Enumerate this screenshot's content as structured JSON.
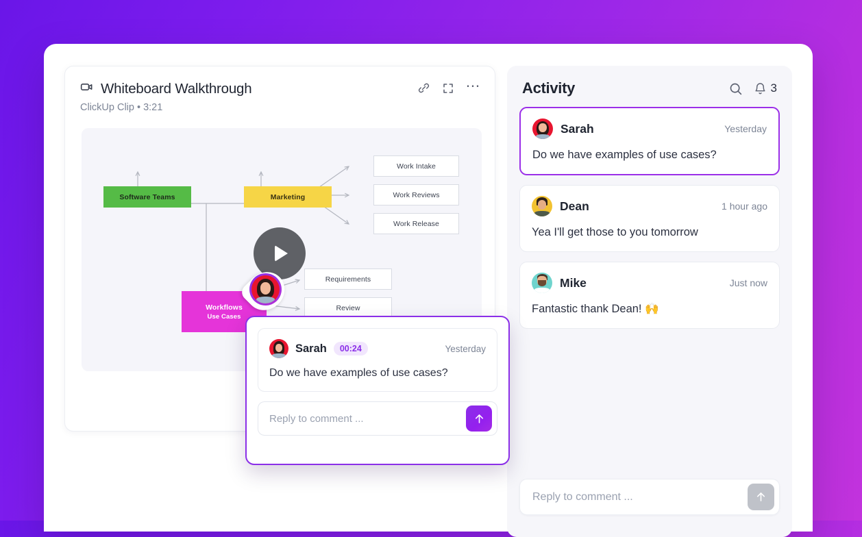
{
  "clip": {
    "icon": "video-camera-icon",
    "title": "Whiteboard Walkthrough",
    "subtitle": "ClickUp Clip • 3:21",
    "actions": [
      {
        "name": "link-icon",
        "label": "Copy link"
      },
      {
        "name": "expand-icon",
        "label": "Fullscreen"
      },
      {
        "name": "more-icon",
        "label": "•••"
      }
    ]
  },
  "board": {
    "nodes": [
      {
        "id": "software-teams",
        "label": "Software Teams",
        "sub": "",
        "color": "#55bb46"
      },
      {
        "id": "marketing",
        "label": "Marketing",
        "sub": "",
        "color": "#f6d546"
      },
      {
        "id": "workflows",
        "label": "Workflows",
        "sub": "Use Cases",
        "color": "#e534d9"
      },
      {
        "id": "work-intake",
        "label": "Work Intake",
        "sub": "",
        "color": "#ffffff"
      },
      {
        "id": "work-reviews",
        "label": "Work Reviews",
        "sub": "",
        "color": "#ffffff"
      },
      {
        "id": "work-release",
        "label": "Work Release",
        "sub": "",
        "color": "#ffffff"
      },
      {
        "id": "requirements",
        "label": "Requirements",
        "sub": "",
        "color": "#ffffff"
      },
      {
        "id": "review",
        "label": "Review",
        "sub": "",
        "color": "#ffffff"
      }
    ],
    "play_button": "play-icon",
    "marker": "sarah-avatar-marker"
  },
  "popup": {
    "author": "Sarah",
    "timestamp_chip": "00:24",
    "date": "Yesterday",
    "text": "Do we have examples of use cases?",
    "reply_placeholder": "Reply to comment ...",
    "reply_value": "",
    "send_icon": "arrow-up-icon",
    "accent": "#8b2fe8"
  },
  "activity": {
    "title": "Activity",
    "search_icon": "search-icon",
    "bell_icon": "bell-icon",
    "notification_count": "3",
    "items": [
      {
        "author": "Sarah",
        "time": "Yesterday",
        "text": "Do we have examples of use cases?",
        "avatar": "sarah-avatar",
        "active": true
      },
      {
        "author": "Dean",
        "time": "1 hour ago",
        "text": "Yea I'll get those to you tomorrow",
        "avatar": "dean-avatar",
        "active": false
      },
      {
        "author": "Mike",
        "time": "Just now",
        "text": "Fantastic thank Dean! 🙌",
        "avatar": "mike-avatar",
        "active": false
      }
    ],
    "reply_placeholder": "Reply to comment ...",
    "reply_value": "",
    "send_icon": "arrow-up-icon"
  }
}
